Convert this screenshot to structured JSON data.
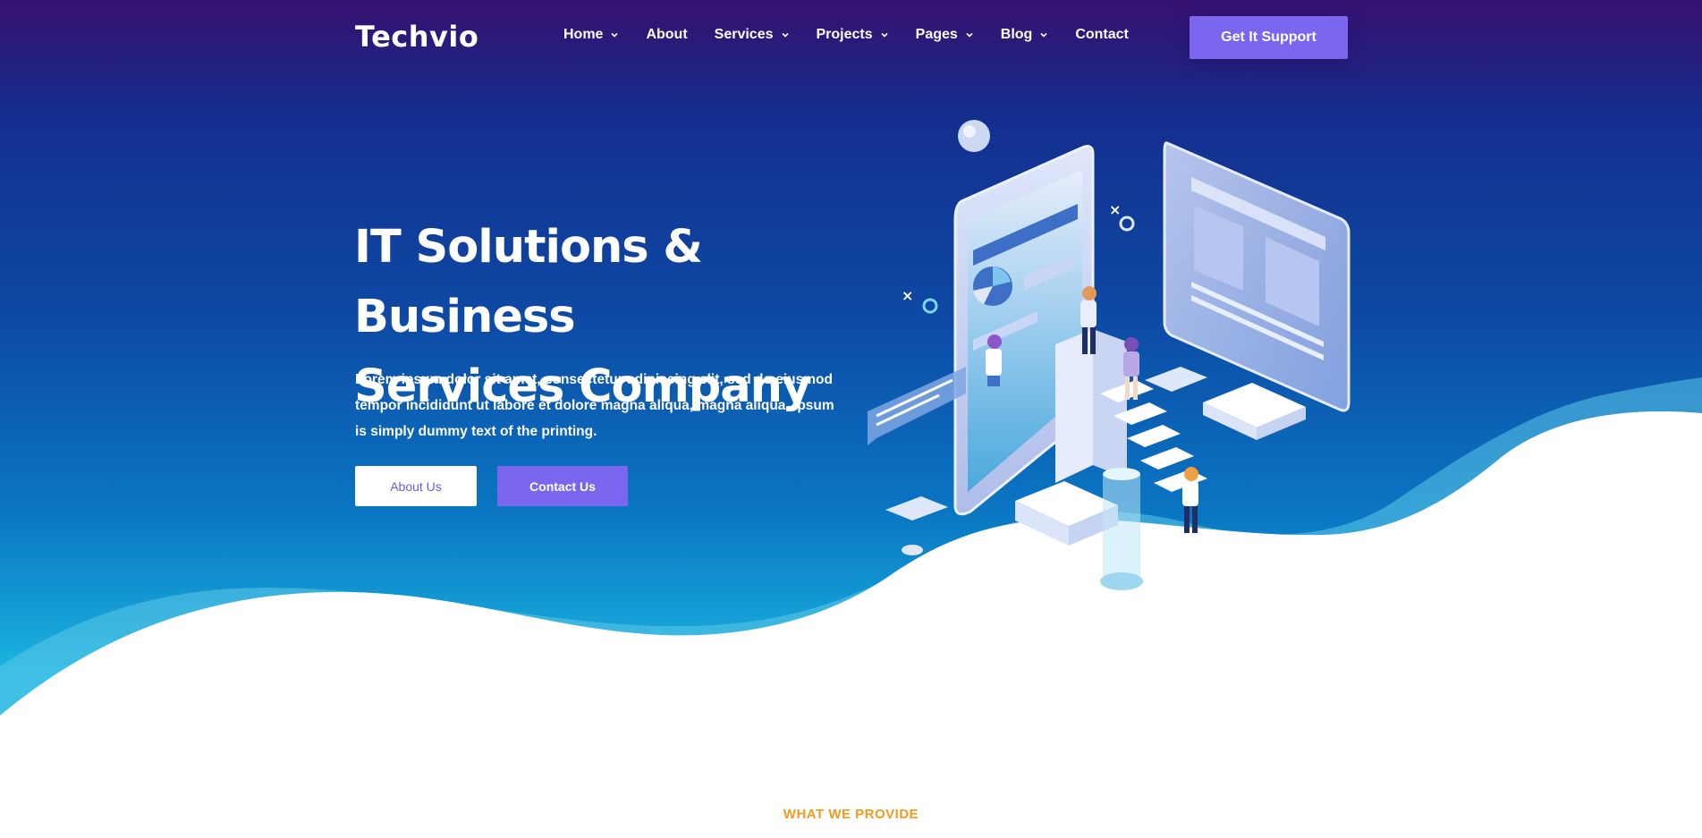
{
  "header": {
    "logo": "Techvio",
    "nav": [
      {
        "label": "Home",
        "has_dropdown": true
      },
      {
        "label": "About",
        "has_dropdown": false
      },
      {
        "label": "Services",
        "has_dropdown": true
      },
      {
        "label": "Projects",
        "has_dropdown": true
      },
      {
        "label": "Pages",
        "has_dropdown": true
      },
      {
        "label": "Blog",
        "has_dropdown": true
      },
      {
        "label": "Contact",
        "has_dropdown": false
      }
    ],
    "cta_label": "Get It Support"
  },
  "hero": {
    "title_line1": "IT Solutions & Business",
    "title_line2": "Services Company",
    "description": "Lorem ipsum dolor sit amet, consectetur adipiscing elit, sed do eiusmod tempor incididunt ut labore et dolore magna aliqua, magna aliqua. ipsum is simply dummy text of the printing.",
    "about_button": "About Us",
    "contact_button": "Contact Us"
  },
  "section": {
    "tag": "WHAT WE PROVIDE"
  },
  "colors": {
    "accent": "#7b67ef",
    "tag": "#f39a1e",
    "hero_top": "#36106f",
    "hero_bottom": "#2ec1e6"
  }
}
